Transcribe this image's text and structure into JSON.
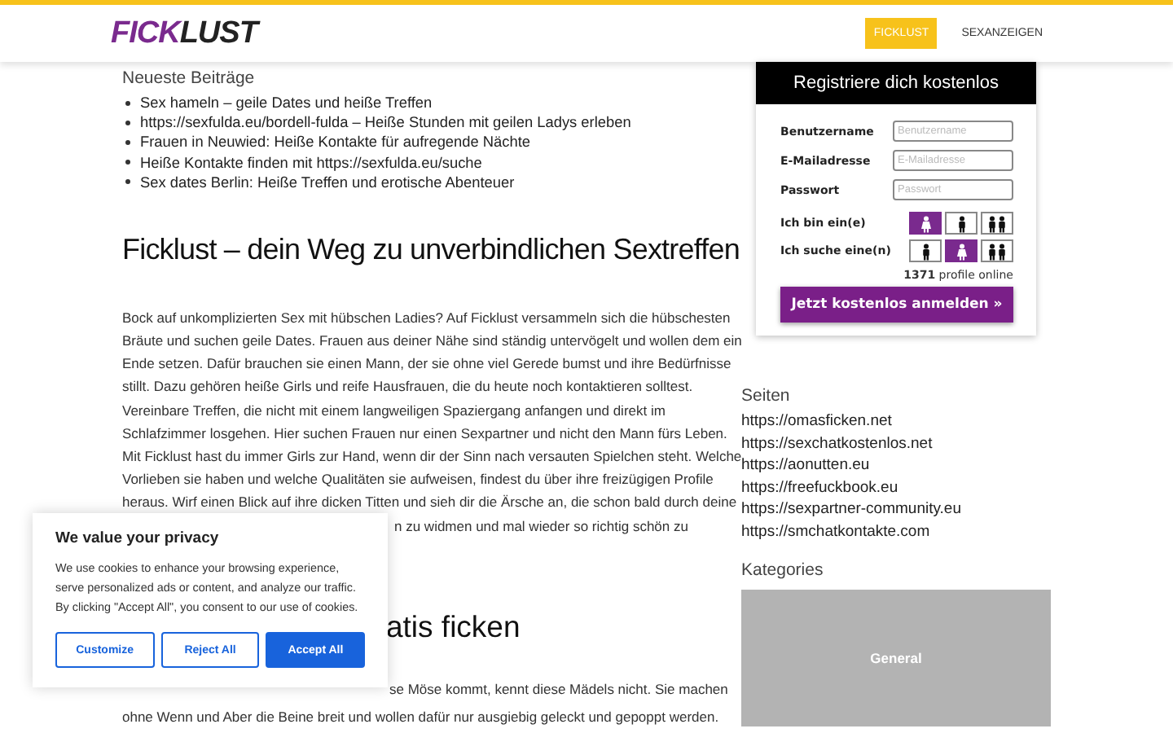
{
  "header": {
    "logo": [
      {
        "text": "FICK",
        "kind": "accent"
      },
      {
        "text": "LUST",
        "kind": "plain"
      }
    ],
    "nav": [
      {
        "label": "FICKLUST",
        "selected": true
      },
      {
        "label": "SEXANZEIGEN",
        "selected": false
      }
    ]
  },
  "recent_posts": {
    "title": "Neueste Beiträge",
    "items": [
      "Sex hameln – geile Dates und heiße Treffen",
      "https://sexfulda.eu/bordell-fulda – Heiße Stunden mit geilen Ladys erleben",
      "Frauen in Neuwied: Heiße Kontakte für aufregende Nächte",
      "Heiße Kontakte finden mit https://sexfulda.eu/suche",
      "Sex dates Berlin: Heiße Treffen und erotische Abenteuer"
    ]
  },
  "article": {
    "heading": "Ficklust – dein Weg zu unverbindlichen Sextreffen",
    "paragraph_lines": [
      "Bock auf unkomplizierten Sex mit hübschen Ladies? Auf Ficklust versammeln sich die hübschesten",
      "Bräute und suchen geile Dates. Frauen aus deiner Nähe sind ständig untervögelt und wollen dem ein",
      "Ende setzen. Dafür brauchen sie einen Mann, der sie ohne viel Gerede bumst und ihre Bedürfnisse",
      "stillt. Dazu gehören heiße Girls und reife Hausfrauen, die du heute noch kontaktieren solltest.",
      "Vereinbare Treffen, die nicht mit einem langweiligen Spaziergang anfangen und direkt im",
      "Schlafzimmer losgehen. Hier suchen Frauen nur einen Sexpartner und nicht den Mann fürs Leben.",
      "Mit Ficklust hast du immer Girls zur Hand, wenn dir der Sinn nach versauten Spielchen steht. Welche",
      "Vorlieben sie haben und welche Qualitäten sie aufweisen, findest du über ihre freizügigen Profile",
      "heraus. Wirf einen Blick auf ihre dicken Titten und sieh dir die Ärsche an, die schon bald durch deine"
    ],
    "partial_line": "n zu widmen und mal wieder so richtig schön zu",
    "subheading": "atis ficken",
    "second_lines": [
      "se Möse kommt, kennt diese Mädels nicht. Sie machen",
      "ohne Wenn und Aber die Beine breit und wollen dafür nur ausgiebig geleckt und gepoppt werden."
    ]
  },
  "register": {
    "title": "Registriere dich kostenlos",
    "fields": [
      {
        "label": "Benutzername",
        "placeholder": "Benutzername"
      },
      {
        "label": "E-Mailadresse",
        "placeholder": "E-Mailadresse"
      },
      {
        "label": "Passwort",
        "placeholder": "Passwort"
      }
    ],
    "gender_rows": [
      {
        "label": "Ich bin ein(e)",
        "options": [
          {
            "kind": "female",
            "selected": true
          },
          {
            "kind": "male",
            "selected": false
          },
          {
            "kind": "couple",
            "selected": false
          }
        ]
      },
      {
        "label": "Ich suche eine(n)",
        "options": [
          {
            "kind": "male",
            "selected": false
          },
          {
            "kind": "female",
            "selected": true
          },
          {
            "kind": "couple",
            "selected": false
          }
        ]
      }
    ],
    "online": "**1371** profile online",
    "submit": "Jetzt kostenlos anmelden »"
  },
  "pages": {
    "title": "Seiten",
    "links": [
      "https://omasficken.net",
      "https://sexchatkostenlos.net",
      "https://aonutten.eu",
      "https://freefuckbook.eu",
      "https://sexpartner-community.eu",
      "https://smchatkontakte.com"
    ]
  },
  "categories": {
    "title": "Kategories",
    "items": [
      "General"
    ]
  },
  "cookie_banner": {
    "title": "We value your privacy",
    "text": "We use cookies to enhance your browsing experience, serve personalized ads or content, and analyze our traffic. By clicking \"Accept All\", you consent to our use of cookies.",
    "buttons": [
      {
        "label": "Customize",
        "kind": "outline"
      },
      {
        "label": "Reject All",
        "kind": "outline"
      },
      {
        "label": "Accept All",
        "kind": "primary"
      }
    ]
  }
}
